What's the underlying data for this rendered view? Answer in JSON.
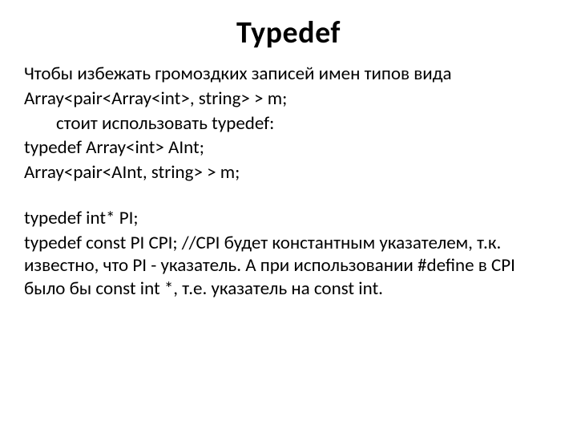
{
  "title": "Typedef",
  "lines": {
    "l1": "Чтобы избежать громоздких записей имен типов вида",
    "l2": "Array<pair<Array<int>, string> > m;",
    "l3": "стоит использовать typedef:",
    "l4": "typedef Array<int> AInt;",
    "l5": "Array<pair<AInt, string> > m;",
    "l6": "typedef int* PI;",
    "l7": "typedef const PI CPI; //CPI будет константным указателем, т.к. известно, что PI - указатель. А при использовании #define в CPI было бы const int *, т.е. указатель на const int."
  }
}
